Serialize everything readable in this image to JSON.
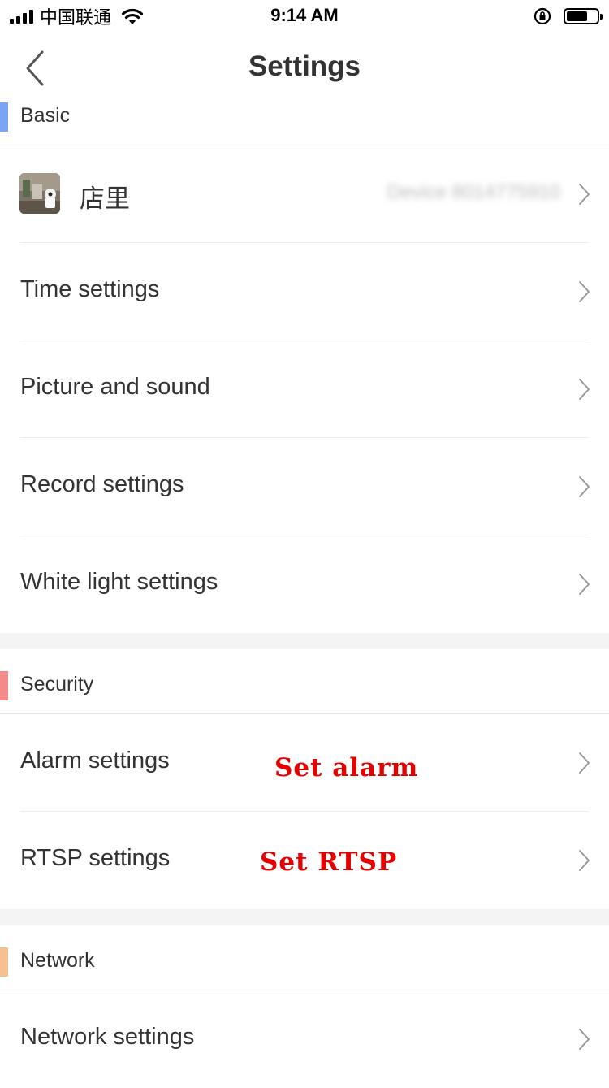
{
  "status_bar": {
    "carrier": "中国联通",
    "time": "9:14 AM",
    "icons": [
      "signal-icon",
      "wifi-icon",
      "rotation-lock-icon",
      "battery-icon"
    ],
    "battery_level": 0.62
  },
  "nav": {
    "title": "Settings",
    "back_icon": "chevron-left-icon"
  },
  "sections": {
    "basic": {
      "title": "Basic",
      "color": "#7aa4f5"
    },
    "security": {
      "title": "Security",
      "color": "#f58a8a"
    },
    "network": {
      "title": "Network",
      "color": "#f8c090"
    }
  },
  "device": {
    "name": "店里",
    "id": "Device 8014775910"
  },
  "rows": {
    "time": "Time settings",
    "picture": "Picture and sound",
    "record": "Record settings",
    "white_light": "White light settings",
    "alarm": "Alarm settings",
    "rtsp": "RTSP settings",
    "network": "Network settings"
  },
  "annotations": {
    "alarm": "Set alarm",
    "rtsp": "Set RTSP",
    "color": "#e60000"
  }
}
